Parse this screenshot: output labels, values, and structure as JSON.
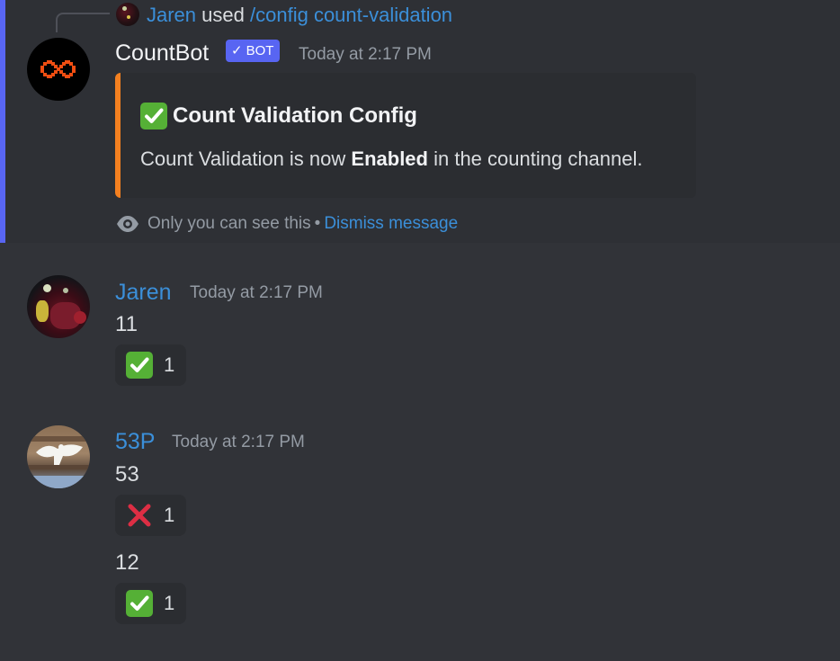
{
  "interaction": {
    "user": "Jaren",
    "used_text": "used",
    "command": "/config count-validation"
  },
  "bot_message": {
    "username": "CountBot",
    "badge": "BOT",
    "badge_check": "✓",
    "timestamp": "Today at 2:17 PM",
    "embed": {
      "accent_color": "#f48020",
      "title_icon": "white-check-mark",
      "title": "Count Validation Config",
      "desc_before": "Count Validation is now ",
      "desc_bold": "Enabled",
      "desc_after": " in the counting channel."
    },
    "ephemeral_note": "Only you can see this",
    "separator": "•",
    "dismiss_label": "Dismiss message"
  },
  "messages": [
    {
      "username": "Jaren",
      "timestamp": "Today at 2:17 PM",
      "text": "11",
      "reaction": {
        "icon": "white-check-mark",
        "count": "1"
      }
    },
    {
      "username": "53P",
      "timestamp": "Today at 2:17 PM",
      "text": "53",
      "reaction": {
        "icon": "cross-mark",
        "count": "1"
      }
    },
    {
      "text": "12",
      "reaction": {
        "icon": "white-check-mark",
        "count": "1"
      }
    }
  ],
  "colors": {
    "background": "#313338",
    "highlight": "#2e3035",
    "highlight_bar": "#5865f2",
    "link": "#3b8fd9",
    "badge": "#5865f2",
    "check": "#55b036",
    "cross": "#dd2e44"
  }
}
